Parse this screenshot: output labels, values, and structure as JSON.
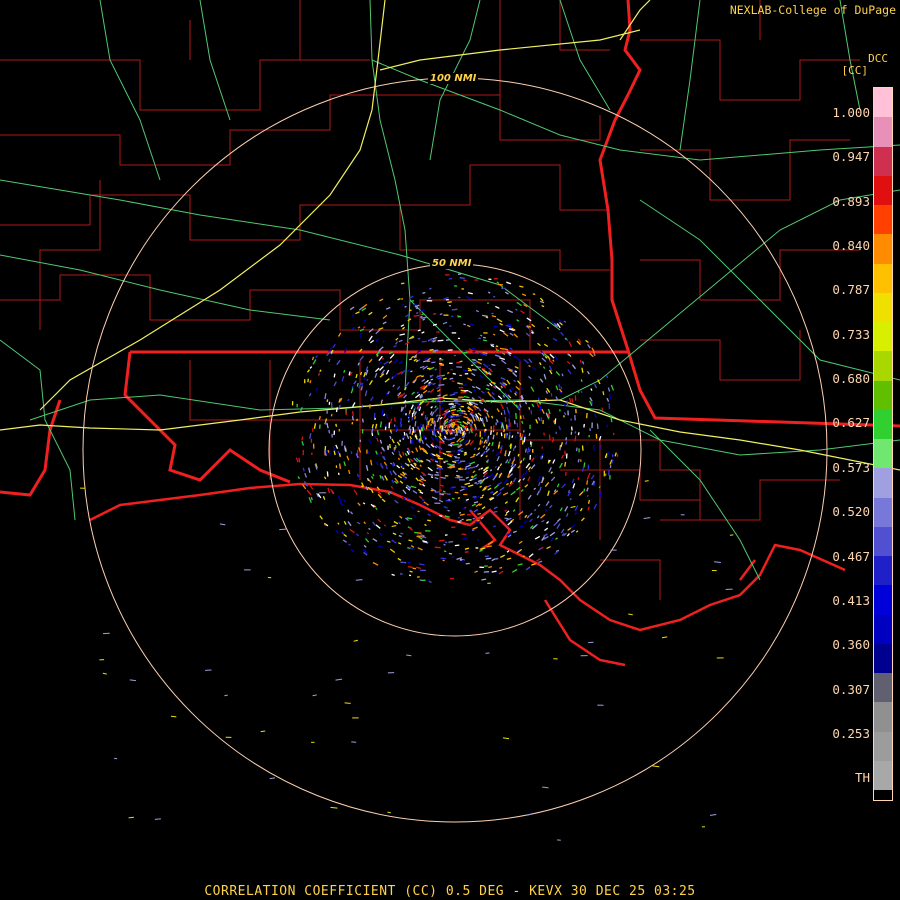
{
  "header": {
    "credit": "NEXLAB-College of DuPage",
    "product_code": "DCC",
    "units": "[CC]"
  },
  "range_rings": [
    {
      "label": "100 NMI"
    },
    {
      "label": "50 NMI"
    }
  ],
  "legend": {
    "ticks": [
      "1.000",
      "0.947",
      "0.893",
      "0.840",
      "0.787",
      "0.733",
      "0.680",
      "0.627",
      "0.573",
      "0.520",
      "0.467",
      "0.413",
      "0.360",
      "0.307",
      "0.253",
      "TH"
    ],
    "colors": [
      "#ffc0d8",
      "#e890b8",
      "#d03050",
      "#e01010",
      "#ff4000",
      "#ff8c00",
      "#ffc000",
      "#f0e000",
      "#d8f000",
      "#a8d800",
      "#60c000",
      "#30d030",
      "#70e870",
      "#a0a0e0",
      "#7878d8",
      "#5050d0",
      "#2020c8",
      "#0000d8",
      "#0000c0",
      "#000090",
      "#606070",
      "#909090",
      "#9c9c9c",
      "#a8a8a8"
    ]
  },
  "footer": {
    "caption": "CORRELATION COEFFICIENT (CC) 0.5 DEG - KEVX 30 DEC 25 03:25"
  }
}
